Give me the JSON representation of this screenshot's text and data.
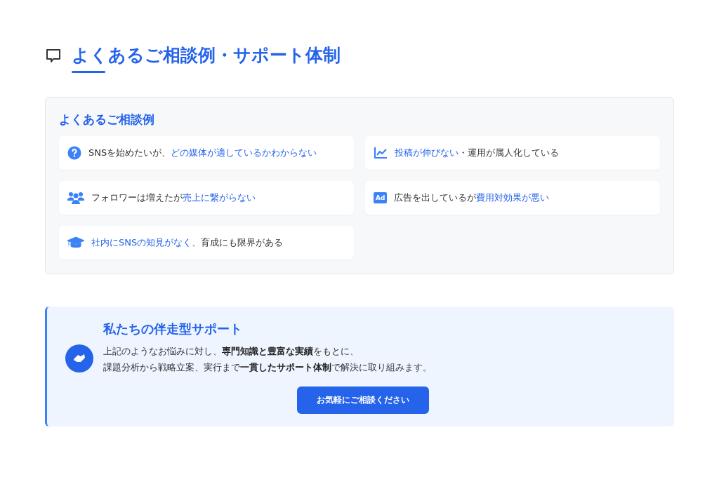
{
  "heading": {
    "title": "よくあるご相談例・サポート体制"
  },
  "cases": {
    "title": "よくあるご相談例",
    "items": [
      {
        "kind": "question",
        "parts": [
          {
            "text": "SNSを始めたいが、",
            "highlight": false
          },
          {
            "text": "どの媒体が適しているかわからない",
            "highlight": true
          }
        ]
      },
      {
        "kind": "chart",
        "parts": [
          {
            "text": "投稿が伸びない",
            "highlight": true
          },
          {
            "text": "・運用が属人化している",
            "highlight": false
          }
        ]
      },
      {
        "kind": "users",
        "parts": [
          {
            "text": "フォロワーは増えたが",
            "highlight": false
          },
          {
            "text": "売上に繋がらない",
            "highlight": true
          }
        ]
      },
      {
        "kind": "ad",
        "icon_text": "Ad",
        "parts": [
          {
            "text": "広告を出しているが",
            "highlight": false
          },
          {
            "text": "費用対効果が悪い",
            "highlight": true
          }
        ]
      },
      {
        "kind": "graduation",
        "parts": [
          {
            "text": "社内にSNSの知見がなく",
            "highlight": true
          },
          {
            "text": "、育成にも限界がある",
            "highlight": false
          }
        ]
      }
    ]
  },
  "support": {
    "title": "私たちの伴走型サポート",
    "lines": [
      "上記のようなお悩みに対し、**専門知識と豊富な実績**をもとに、",
      "課題分析から戦略立案、実行まで**一貫したサポート体制**で解決に取り組みます。"
    ],
    "button": "お気軽にご相談ください"
  }
}
